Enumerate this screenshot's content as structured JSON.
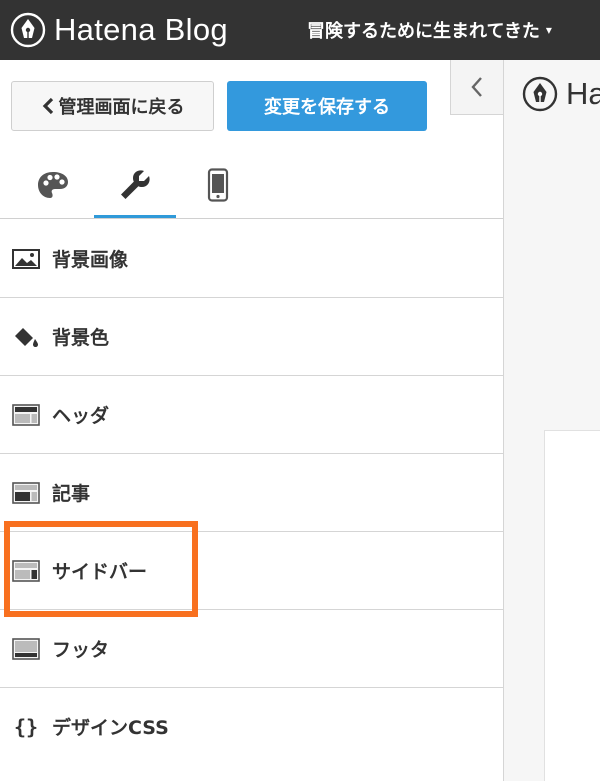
{
  "app": {
    "brand": "Hatena Blog",
    "blog_title": "冒険するために生まれてきた"
  },
  "sidebar": {
    "back_label": "管理画面に戻る",
    "save_label": "変更を保存する",
    "collapse_icon": "chevron-left-icon",
    "tabs": [
      {
        "icon": "palette-icon",
        "active": false
      },
      {
        "icon": "wrench-icon",
        "active": true
      },
      {
        "icon": "smartphone-icon",
        "active": false
      }
    ],
    "items": [
      {
        "label": "背景画像",
        "icon": "image-icon"
      },
      {
        "label": "背景色",
        "icon": "paint-bucket-icon"
      },
      {
        "label": "ヘッダ",
        "icon": "header-layout-icon"
      },
      {
        "label": "記事",
        "icon": "article-layout-icon"
      },
      {
        "label": "サイドバー",
        "icon": "sidebar-layout-icon"
      },
      {
        "label": "フッタ",
        "icon": "footer-layout-icon"
      },
      {
        "label": "デザインCSS",
        "icon": "braces-icon"
      }
    ]
  },
  "preview": {
    "title": "Hatena Blog"
  },
  "colors": {
    "topbar": "#333333",
    "accent_blue": "#3399dd",
    "highlight_orange": "#f8701f",
    "tab_underline": "#2f9ad9"
  }
}
